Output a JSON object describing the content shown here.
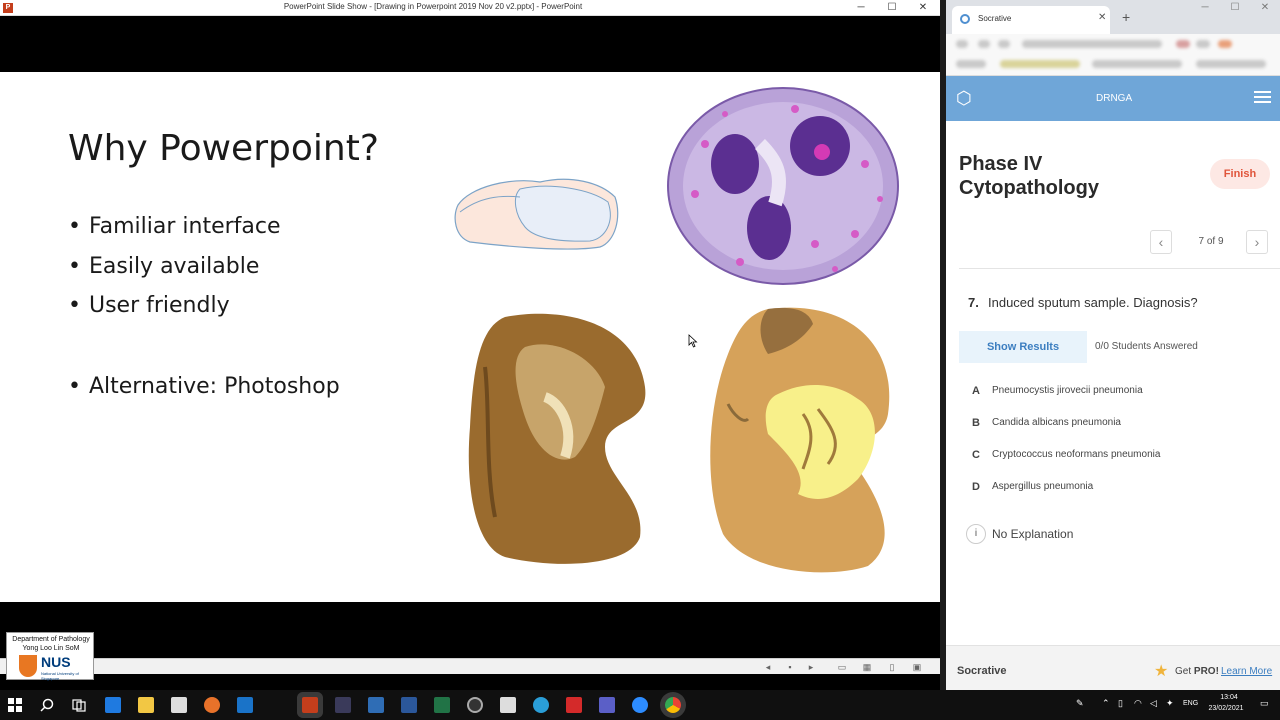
{
  "ppt": {
    "window_title": "PowerPoint Slide Show - [Drawing in Powerpoint 2019 Nov 20 v2.pptx] - PowerPoint",
    "window_controls": {
      "minimize": "─",
      "maximize": "☐",
      "close": "✕"
    },
    "slide": {
      "title": "Why Powerpoint?",
      "bullets": [
        "Familiar interface",
        "Easily available",
        "User friendly"
      ],
      "extra_bullet": "Alternative: Photoshop"
    },
    "overlay_logo": {
      "dept_line1": "Department of Pathology",
      "dept_line2": "Yong Loo Lin SoM",
      "brand": "NUS",
      "brand_sub": "National University of Singapore"
    }
  },
  "browser": {
    "tab_title": "Socrative",
    "tab_close": "✕",
    "new_tab": "+",
    "window_controls": {
      "minimize": "─",
      "maximize": "☐",
      "close": "✕"
    }
  },
  "socrative": {
    "room_name": "DRNGA",
    "quiz_title": "Phase IV Cytopathology",
    "finish_label": "Finish",
    "prev": "‹",
    "next": "›",
    "page_indicator": "7 of 9",
    "question_number": "7.",
    "question_text": "Induced sputum sample. Diagnosis?",
    "show_results_label": "Show Results",
    "answered_text": "0/0 Students Answered",
    "options": [
      {
        "letter": "A",
        "text": "Pneumocystis jirovecii pneumonia"
      },
      {
        "letter": "B",
        "text": "Candida albicans pneumonia"
      },
      {
        "letter": "C",
        "text": "Cryptococcus neoformans pneumonia"
      },
      {
        "letter": "D",
        "text": "Aspergillus pneumonia"
      }
    ],
    "explanation_icon": "i",
    "explanation_text": "No Explanation",
    "footer_brand": "Socrative",
    "get_label": "Get ",
    "pro_label": "PRO!",
    "learn_more": "Learn More"
  },
  "taskbar": {
    "language": "ENG",
    "time": "13:04",
    "date": "23/02/2021"
  }
}
